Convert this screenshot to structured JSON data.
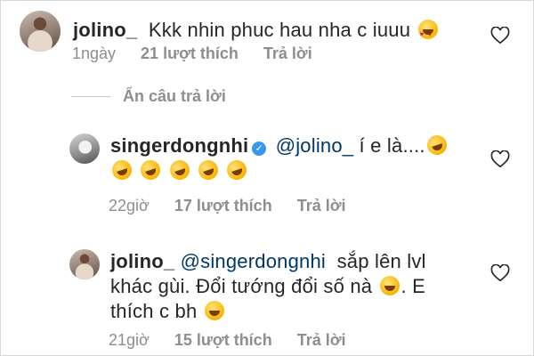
{
  "comments": [
    {
      "username": "jolino_",
      "text": "Kkk nhin phuc hau nha c iuuu",
      "emoji_icons": [
        "heart-eyes-emoji"
      ],
      "time": "1ngày",
      "likes": "21 lượt thích",
      "reply_label": "Trả lời"
    },
    {
      "username": "singerdongnhi",
      "verified": true,
      "mention": "@jolino_",
      "text": "í e là....",
      "emoji_icons": [
        "rolling-laughing-emoji"
      ],
      "time": "22giờ",
      "likes": "17 lượt thích",
      "reply_label": "Trả lời"
    },
    {
      "username": "jolino_",
      "mention": "@singerdongnhi",
      "text_line1": "sắp lên lvl",
      "text_line2": "khác gùi. Đổi tướng đổi số nà",
      "text_line2b": ". E",
      "text_line3": "thích c bh",
      "emoji_icons": [
        "grinning-squint-emoji",
        "kissing-heart-emoji"
      ],
      "time": "21giờ",
      "likes": "15 lượt thích",
      "reply_label": "Trả lời"
    }
  ],
  "hide_replies_label": "Ẩn câu trả lời",
  "colors": {
    "text": "#262626",
    "meta": "#8e8e8e",
    "mention": "#00376b",
    "verified": "#3897f0"
  }
}
